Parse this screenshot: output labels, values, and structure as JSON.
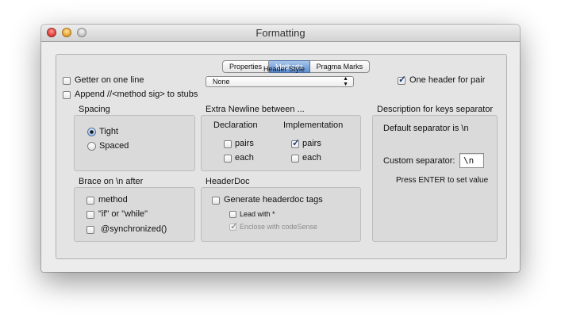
{
  "window": {
    "title": "Formatting"
  },
  "tabs": [
    {
      "label": "Properties",
      "active": false
    },
    {
      "label": "Methods",
      "active": true
    },
    {
      "label": "Pragma Marks",
      "active": false
    }
  ],
  "header_style": {
    "label": "Header Style",
    "value": "None"
  },
  "options": {
    "getter_one_line": {
      "label": "Getter on one line",
      "checked": false
    },
    "append_method_sig": {
      "label": "Append //<method sig> to stubs",
      "checked": false
    },
    "one_header_for_pair": {
      "label": "One header for pair",
      "checked": true
    }
  },
  "spacing": {
    "title": "Spacing",
    "options": [
      {
        "label": "Tight",
        "selected": true
      },
      {
        "label": "Spaced",
        "selected": false
      }
    ]
  },
  "extra_newline": {
    "title": "Extra Newline between ...",
    "declaration": {
      "title": "Declaration",
      "pairs": {
        "label": "pairs",
        "checked": false
      },
      "each": {
        "label": "each",
        "checked": false
      }
    },
    "implementation": {
      "title": "Implementation",
      "pairs": {
        "label": "pairs",
        "checked": true
      },
      "each": {
        "label": "each",
        "checked": false
      }
    }
  },
  "brace": {
    "title": "Brace on \\n after",
    "method": {
      "label": "method",
      "checked": false
    },
    "if_while": {
      "label": "\"if\" or \"while\"",
      "checked": false
    },
    "synchronized": {
      "label": "@synchronized()",
      "checked": false
    }
  },
  "headerdoc": {
    "title": "HeaderDoc",
    "generate": {
      "label": "Generate headerdoc tags",
      "checked": false
    },
    "lead_with": {
      "label": "Lead with *",
      "checked": false
    },
    "enclose": {
      "label": "Enclose with codeSense",
      "checked": true
    }
  },
  "separator": {
    "title": "Description for keys separator",
    "default_text": "Default separator is \\n",
    "custom_label": "Custom separator:",
    "custom_value": "\\n",
    "hint": "Press ENTER  to set value"
  },
  "colors": {
    "selected_tab": "#5d8fd3",
    "panel": "#dadada",
    "window": "#ececec"
  }
}
